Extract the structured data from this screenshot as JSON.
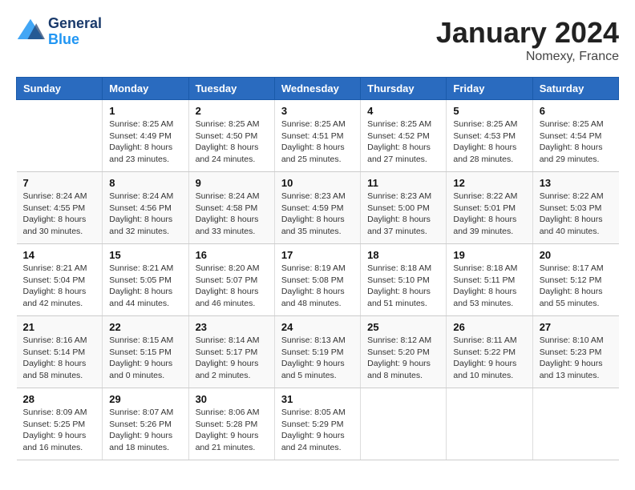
{
  "header": {
    "logo_general": "General",
    "logo_blue": "Blue",
    "month": "January 2024",
    "location": "Nomexy, France"
  },
  "days_of_week": [
    "Sunday",
    "Monday",
    "Tuesday",
    "Wednesday",
    "Thursday",
    "Friday",
    "Saturday"
  ],
  "weeks": [
    [
      {
        "day": "",
        "info": ""
      },
      {
        "day": "1",
        "info": "Sunrise: 8:25 AM\nSunset: 4:49 PM\nDaylight: 8 hours\nand 23 minutes."
      },
      {
        "day": "2",
        "info": "Sunrise: 8:25 AM\nSunset: 4:50 PM\nDaylight: 8 hours\nand 24 minutes."
      },
      {
        "day": "3",
        "info": "Sunrise: 8:25 AM\nSunset: 4:51 PM\nDaylight: 8 hours\nand 25 minutes."
      },
      {
        "day": "4",
        "info": "Sunrise: 8:25 AM\nSunset: 4:52 PM\nDaylight: 8 hours\nand 27 minutes."
      },
      {
        "day": "5",
        "info": "Sunrise: 8:25 AM\nSunset: 4:53 PM\nDaylight: 8 hours\nand 28 minutes."
      },
      {
        "day": "6",
        "info": "Sunrise: 8:25 AM\nSunset: 4:54 PM\nDaylight: 8 hours\nand 29 minutes."
      }
    ],
    [
      {
        "day": "7",
        "info": "Sunrise: 8:24 AM\nSunset: 4:55 PM\nDaylight: 8 hours\nand 30 minutes."
      },
      {
        "day": "8",
        "info": "Sunrise: 8:24 AM\nSunset: 4:56 PM\nDaylight: 8 hours\nand 32 minutes."
      },
      {
        "day": "9",
        "info": "Sunrise: 8:24 AM\nSunset: 4:58 PM\nDaylight: 8 hours\nand 33 minutes."
      },
      {
        "day": "10",
        "info": "Sunrise: 8:23 AM\nSunset: 4:59 PM\nDaylight: 8 hours\nand 35 minutes."
      },
      {
        "day": "11",
        "info": "Sunrise: 8:23 AM\nSunset: 5:00 PM\nDaylight: 8 hours\nand 37 minutes."
      },
      {
        "day": "12",
        "info": "Sunrise: 8:22 AM\nSunset: 5:01 PM\nDaylight: 8 hours\nand 39 minutes."
      },
      {
        "day": "13",
        "info": "Sunrise: 8:22 AM\nSunset: 5:03 PM\nDaylight: 8 hours\nand 40 minutes."
      }
    ],
    [
      {
        "day": "14",
        "info": "Sunrise: 8:21 AM\nSunset: 5:04 PM\nDaylight: 8 hours\nand 42 minutes."
      },
      {
        "day": "15",
        "info": "Sunrise: 8:21 AM\nSunset: 5:05 PM\nDaylight: 8 hours\nand 44 minutes."
      },
      {
        "day": "16",
        "info": "Sunrise: 8:20 AM\nSunset: 5:07 PM\nDaylight: 8 hours\nand 46 minutes."
      },
      {
        "day": "17",
        "info": "Sunrise: 8:19 AM\nSunset: 5:08 PM\nDaylight: 8 hours\nand 48 minutes."
      },
      {
        "day": "18",
        "info": "Sunrise: 8:18 AM\nSunset: 5:10 PM\nDaylight: 8 hours\nand 51 minutes."
      },
      {
        "day": "19",
        "info": "Sunrise: 8:18 AM\nSunset: 5:11 PM\nDaylight: 8 hours\nand 53 minutes."
      },
      {
        "day": "20",
        "info": "Sunrise: 8:17 AM\nSunset: 5:12 PM\nDaylight: 8 hours\nand 55 minutes."
      }
    ],
    [
      {
        "day": "21",
        "info": "Sunrise: 8:16 AM\nSunset: 5:14 PM\nDaylight: 8 hours\nand 58 minutes."
      },
      {
        "day": "22",
        "info": "Sunrise: 8:15 AM\nSunset: 5:15 PM\nDaylight: 9 hours\nand 0 minutes."
      },
      {
        "day": "23",
        "info": "Sunrise: 8:14 AM\nSunset: 5:17 PM\nDaylight: 9 hours\nand 2 minutes."
      },
      {
        "day": "24",
        "info": "Sunrise: 8:13 AM\nSunset: 5:19 PM\nDaylight: 9 hours\nand 5 minutes."
      },
      {
        "day": "25",
        "info": "Sunrise: 8:12 AM\nSunset: 5:20 PM\nDaylight: 9 hours\nand 8 minutes."
      },
      {
        "day": "26",
        "info": "Sunrise: 8:11 AM\nSunset: 5:22 PM\nDaylight: 9 hours\nand 10 minutes."
      },
      {
        "day": "27",
        "info": "Sunrise: 8:10 AM\nSunset: 5:23 PM\nDaylight: 9 hours\nand 13 minutes."
      }
    ],
    [
      {
        "day": "28",
        "info": "Sunrise: 8:09 AM\nSunset: 5:25 PM\nDaylight: 9 hours\nand 16 minutes."
      },
      {
        "day": "29",
        "info": "Sunrise: 8:07 AM\nSunset: 5:26 PM\nDaylight: 9 hours\nand 18 minutes."
      },
      {
        "day": "30",
        "info": "Sunrise: 8:06 AM\nSunset: 5:28 PM\nDaylight: 9 hours\nand 21 minutes."
      },
      {
        "day": "31",
        "info": "Sunrise: 8:05 AM\nSunset: 5:29 PM\nDaylight: 9 hours\nand 24 minutes."
      },
      {
        "day": "",
        "info": ""
      },
      {
        "day": "",
        "info": ""
      },
      {
        "day": "",
        "info": ""
      }
    ]
  ]
}
